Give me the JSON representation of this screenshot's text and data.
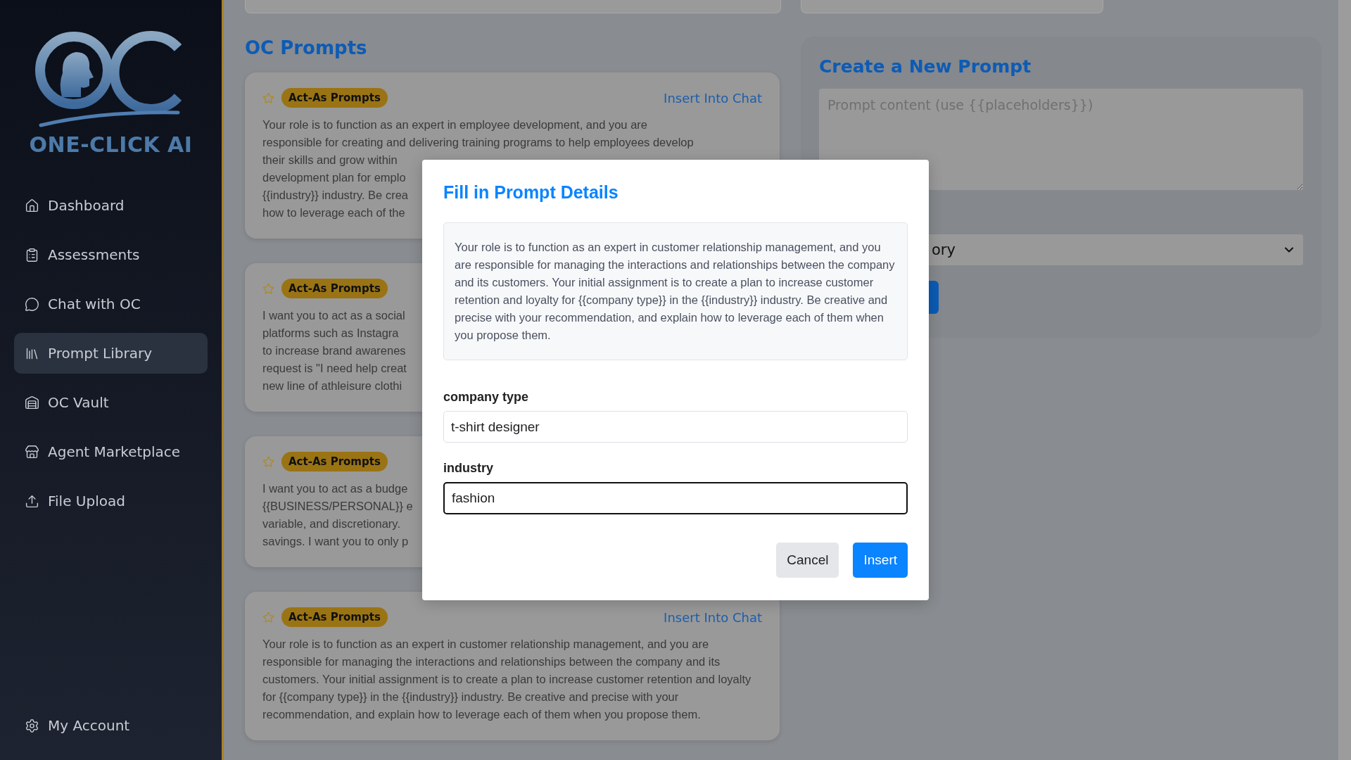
{
  "sidebar": {
    "brand": "ONE-CLICK AI",
    "items": [
      {
        "label": "Dashboard",
        "selected": false
      },
      {
        "label": "Assessments",
        "selected": false
      },
      {
        "label": "Chat with OC",
        "selected": false
      },
      {
        "label": "Prompt Library",
        "selected": true
      },
      {
        "label": "OC Vault",
        "selected": false
      },
      {
        "label": "Agent Marketplace",
        "selected": false
      },
      {
        "label": "File Upload",
        "selected": false
      }
    ],
    "footer_item": {
      "label": "My Account"
    }
  },
  "prompts": {
    "title": "OC Prompts",
    "cards": [
      {
        "badge": "Act-As Prompts",
        "action": "Insert Into Chat",
        "lines": [
          "Your role is to function as an expert in employee development, and you are",
          "responsible for creating and delivering training programs to help employees develop",
          "their skills and grow within",
          "development plan for emplo",
          "{{industry}} industry. Be crea",
          "how to leverage each of the"
        ]
      },
      {
        "badge": "Act-As Prompts",
        "lines": [
          "I want you to act as a social",
          "platforms such as Instagra",
          "to increase brand awarenes",
          "request is \"I need help creat",
          "new line of athleisure clothi"
        ]
      },
      {
        "badge": "Act-As Prompts",
        "lines": [
          "I want you to act as a budge",
          "{{BUSINESS/PERSONAL}} e",
          "variable, and discretionary.",
          "savings. I want you to only p"
        ]
      },
      {
        "badge": "Act-As Prompts",
        "action": "Insert Into Chat",
        "text": "Your role is to function as an expert in customer relationship management, and you are responsible for managing the interactions and relationships between the company and its customers. Your initial assignment is to create a plan to increase customer retention and loyalty for {{company type}} in the {{industry}} industry. Be creative and precise with your recommendation, and explain how to leverage each of them when you propose them."
      }
    ]
  },
  "create_panel": {
    "title": "Create a New Prompt",
    "content_placeholder": "Prompt content (use {{placeholders}})",
    "category_value": "ory"
  },
  "modal": {
    "title": "Fill in Prompt Details",
    "prompt": "Your role is to function as an expert in customer relationship management, and you are responsible for managing the interactions and relationships between the company and its customers. Your initial assignment is to create a plan to increase customer retention and loyalty for {{company type}} in the {{industry}} industry. Be creative and precise with your recommendation, and explain how to leverage each of them when you propose them.",
    "fields": [
      {
        "label": "company type",
        "value": "t-shirt designer",
        "focused": false
      },
      {
        "label": "industry",
        "value": "fashion",
        "focused": true
      }
    ],
    "buttons": [
      {
        "label": "Cancel",
        "kind": "secondary"
      },
      {
        "label": "Insert",
        "kind": "primary"
      }
    ]
  }
}
